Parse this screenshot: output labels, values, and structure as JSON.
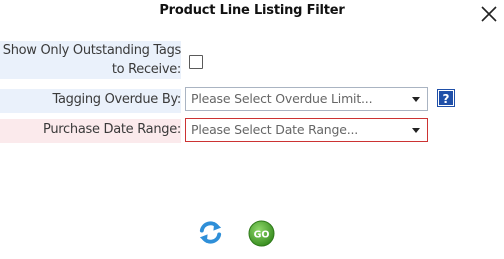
{
  "dialog": {
    "title": "Product Line Listing Filter"
  },
  "fields": {
    "outstanding": {
      "label_line1": "Show Only Outstanding Tags",
      "label_line2": "to Receive:",
      "checked": false
    },
    "overdue": {
      "label": "Tagging Overdue By:",
      "value": "Please Select Overdue Limit..."
    },
    "purchase_date": {
      "label": "Purchase Date Range:",
      "value": "Please Select Date Range..."
    }
  },
  "icons": {
    "close": "close-icon",
    "help": "help-icon",
    "refresh": "refresh-icon",
    "go": "go-icon"
  },
  "go_button": {
    "label": "GO"
  },
  "colors": {
    "label_blue_bg": "#eaf1fb",
    "label_pink_bg": "#fbeaec",
    "required_border": "#cc3333",
    "help_blue": "#1f4fa8",
    "go_green": "#4aa52e",
    "refresh_blue": "#2f8fd8"
  }
}
